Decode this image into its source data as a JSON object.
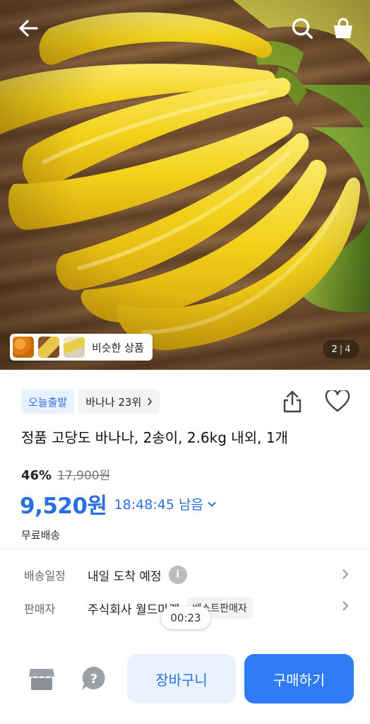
{
  "hero": {
    "similar_label": "비슷한 상품",
    "page_current": "2",
    "page_separator": "|",
    "page_total": "4"
  },
  "product": {
    "badge_today": "오늘출발",
    "rank_label": "바나나 23위",
    "title": "정품 고당도 바나나, 2송이, 2.6kg 내외, 1개",
    "discount": "46%",
    "original_price": "17,900원",
    "price": "9,520원",
    "timer": "18:48:45 남음",
    "shipping": "무료배송"
  },
  "info": {
    "delivery_key": "배송일정",
    "delivery_val": "내일 도착 예정",
    "seller_key": "판매자",
    "seller_val": "주식회사 월드마켓",
    "seller_badge": "베스트판매자"
  },
  "video_timer": "00:23",
  "bottom": {
    "cart_label": "장바구니",
    "buy_label": "구매하기"
  },
  "colors": {
    "accent": "#2a6fe0",
    "buy_button": "#2f7cf6",
    "cart_button_bg": "#e9f2ff"
  },
  "icons": [
    "back-arrow-icon",
    "search-icon",
    "shopping-bag-icon",
    "share-icon",
    "heart-icon",
    "info-icon",
    "chevron-right-icon",
    "chevron-down-icon",
    "store-icon",
    "help-icon"
  ]
}
